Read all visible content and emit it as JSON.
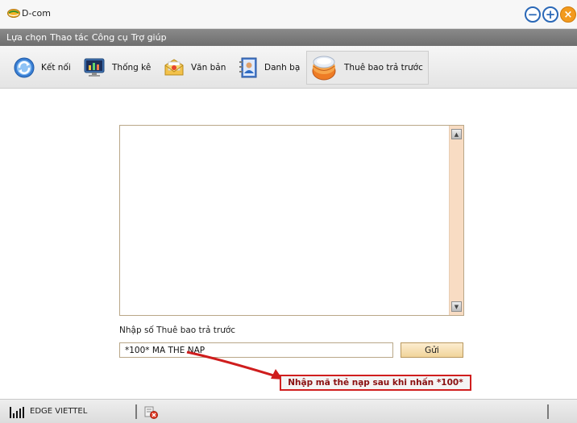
{
  "window": {
    "title": "D-com",
    "minimize_glyph": "−",
    "maximize_glyph": "+",
    "close_glyph": "×"
  },
  "menu": {
    "items": [
      "Lựa chọn",
      "Thao tác",
      "Công cụ",
      "Trợ giúp"
    ]
  },
  "toolbar": {
    "items": [
      {
        "label": "Kết nối",
        "icon": "refresh-connect-icon"
      },
      {
        "label": "Thống kê",
        "icon": "monitor-chart-icon"
      },
      {
        "label": "Văn bản",
        "icon": "envelope-icon"
      },
      {
        "label": "Danh bạ",
        "icon": "address-book-icon"
      },
      {
        "label": "Thuê bao trả trước",
        "icon": "prepaid-sim-icon",
        "active": true
      }
    ]
  },
  "main": {
    "log_text": "",
    "input_label": "Nhập số Thuê bao trả trước",
    "code_input_value": "*100* MÃ THẺ NẠP",
    "send_label": "Gửi",
    "callout_text": "Nhập mã thẻ nạp sau khi nhấn *100*"
  },
  "status": {
    "network": "EDGE VIETTEL",
    "signal_icon": "signal-bars-icon",
    "sms_icon": "sms-error-icon"
  },
  "colors": {
    "menubar": "#7c7c7c",
    "accent_blue": "#2a68b7",
    "close_orange": "#f29a1e",
    "callout_red": "#d01e1e",
    "scrollbar": "#f8dcc3"
  }
}
